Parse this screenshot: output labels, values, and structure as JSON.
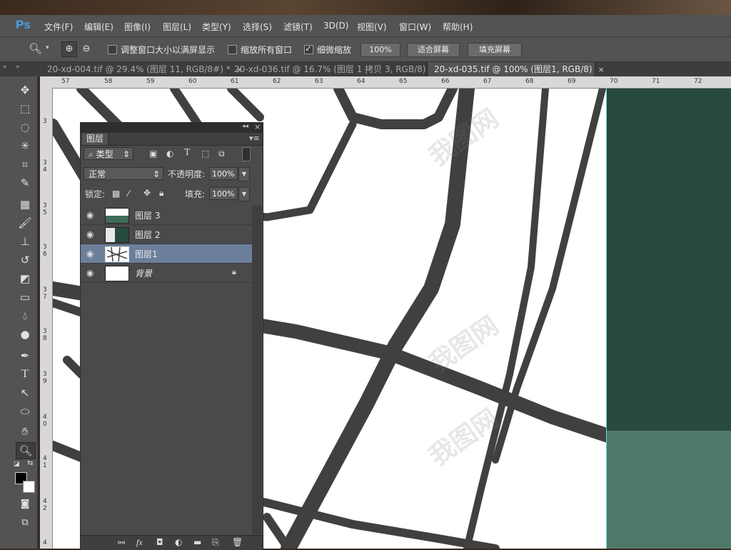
{
  "app": {
    "logo": "Ps"
  },
  "menu": [
    "文件(F)",
    "编辑(E)",
    "图像(I)",
    "图层(L)",
    "类型(Y)",
    "选择(S)",
    "滤镜(T)",
    "3D(D)",
    "视图(V)",
    "窗口(W)",
    "帮助(H)"
  ],
  "options": {
    "resize_windows": "调整窗口大小以满屏显示",
    "zoom_all": "缩放所有窗口",
    "scrubby_zoom": "细微缩放",
    "scrubby_checked": true,
    "btn_100": "100%",
    "btn_fit": "适合屏幕",
    "btn_fill": "填充屏幕"
  },
  "tabs": [
    {
      "title": "20-xd-004.tif @ 29.4% (图层 11, RGB/8#) *",
      "active": false
    },
    {
      "title": "20-xd-036.tif @ 16.7% (图层 1 拷贝 3, RGB/8)",
      "active": false
    },
    {
      "title": "20-xd-035.tif @ 100% (图层1, RGB/8)",
      "active": true
    }
  ],
  "tab_close": "×",
  "ruler_h": [
    "57",
    "58",
    "59",
    "60",
    "61",
    "62",
    "63",
    "64",
    "65",
    "66",
    "67",
    "68",
    "69",
    "70",
    "71",
    "72"
  ],
  "ruler_v": [
    "3",
    "3",
    "4",
    "3",
    "5",
    "3",
    "6",
    "3",
    "7",
    "3",
    "8",
    "3",
    "9",
    "4",
    "0",
    "4",
    "1",
    "4",
    "2",
    "4",
    "3",
    "4"
  ],
  "layers_panel": {
    "title": "图层",
    "filter_kind": "类型",
    "blend_mode": "正常",
    "opacity_label": "不透明度:",
    "opacity_value": "100%",
    "lock_label": "锁定:",
    "fill_label": "填充:",
    "fill_value": "100%",
    "layers": [
      {
        "name": "图层 3",
        "selected": false,
        "thumb": "checker-green"
      },
      {
        "name": "图层 2",
        "selected": false,
        "thumb": "checker-darkgreen"
      },
      {
        "name": "图层1",
        "selected": true,
        "thumb": "map-lines"
      },
      {
        "name": "背景",
        "selected": false,
        "thumb": "white",
        "locked": true
      }
    ],
    "footer_icons": [
      "link-icon",
      "fx-icon",
      "mask-icon",
      "adjustment-icon",
      "folder-icon",
      "new-layer-icon",
      "trash-icon"
    ],
    "fx": "fx"
  },
  "colors": {
    "canvas_green_dark": "#284a3e",
    "canvas_green_light": "#4f7a69",
    "road": "#404040",
    "selected_layer": "#6b7f9b"
  },
  "watermark": "我图网"
}
